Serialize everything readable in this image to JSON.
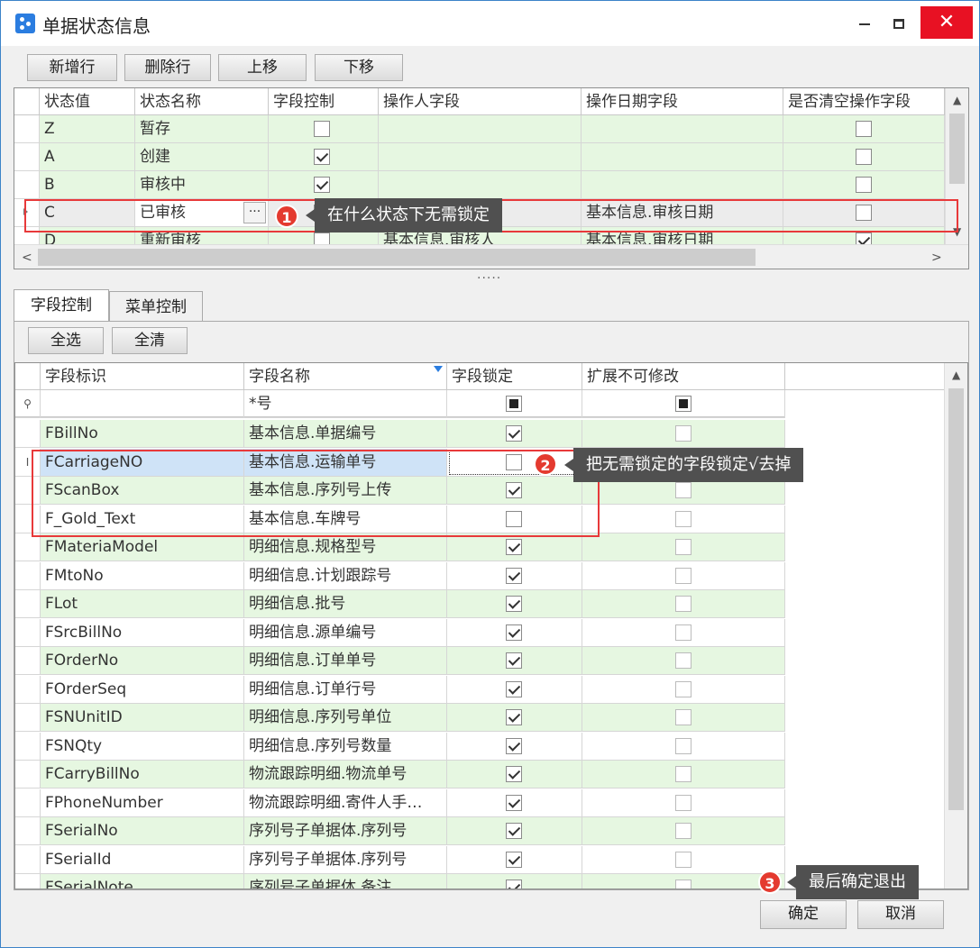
{
  "window": {
    "title": "单据状态信息",
    "close_glyph": "✕"
  },
  "toolbar": {
    "add": "新增行",
    "delete": "删除行",
    "up": "上移",
    "down": "下移"
  },
  "status_grid": {
    "columns": [
      "状态值",
      "状态名称",
      "字段控制",
      "操作人字段",
      "操作日期字段",
      "是否清空操作字段"
    ],
    "rows": [
      {
        "value": "Z",
        "name": "暂存",
        "field_control": false,
        "operator": "",
        "date": "",
        "clear": false
      },
      {
        "value": "A",
        "name": "创建",
        "field_control": true,
        "operator": "",
        "date": "",
        "clear": false
      },
      {
        "value": "B",
        "name": "审核中",
        "field_control": true,
        "operator": "",
        "date": "",
        "clear": false
      },
      {
        "value": "C",
        "name": "已审核",
        "field_control": false,
        "operator": "",
        "date": "基本信息.审核日期",
        "clear": false
      },
      {
        "value": "D",
        "name": "重新审核",
        "field_control": false,
        "operator": "基本信息.审核人",
        "date": "基本信息.审核日期",
        "clear": true
      }
    ],
    "ellipsis": "···"
  },
  "splitter": "·····",
  "tabs": [
    "字段控制",
    "菜单控制"
  ],
  "field_toolbar": {
    "select_all": "全选",
    "clear_all": "全清"
  },
  "field_grid": {
    "columns": [
      "字段标识",
      "字段名称",
      "字段锁定",
      "扩展不可修改"
    ],
    "filter": {
      "name": "*号"
    },
    "rows": [
      {
        "id": "FBillNo",
        "name": "基本信息.单据编号",
        "lock": true,
        "ext": false
      },
      {
        "id": "FCarriageNO",
        "name": "基本信息.运输单号",
        "lock": false,
        "ext": false
      },
      {
        "id": "FScanBox",
        "name": "基本信息.序列号上传",
        "lock": true,
        "ext": false
      },
      {
        "id": "F_Gold_Text",
        "name": "基本信息.车牌号",
        "lock": false,
        "ext": false
      },
      {
        "id": "FMateriaModel",
        "name": "明细信息.规格型号",
        "lock": true,
        "ext": false
      },
      {
        "id": "FMtoNo",
        "name": "明细信息.计划跟踪号",
        "lock": true,
        "ext": false
      },
      {
        "id": "FLot",
        "name": "明细信息.批号",
        "lock": true,
        "ext": false
      },
      {
        "id": "FSrcBillNo",
        "name": "明细信息.源单编号",
        "lock": true,
        "ext": false
      },
      {
        "id": "FOrderNo",
        "name": "明细信息.订单单号",
        "lock": true,
        "ext": false
      },
      {
        "id": "FOrderSeq",
        "name": "明细信息.订单行号",
        "lock": true,
        "ext": false
      },
      {
        "id": "FSNUnitID",
        "name": "明细信息.序列号单位",
        "lock": true,
        "ext": false
      },
      {
        "id": "FSNQty",
        "name": "明细信息.序列号数量",
        "lock": true,
        "ext": false
      },
      {
        "id": "FCarryBillNo",
        "name": "物流跟踪明细.物流单号",
        "lock": true,
        "ext": false
      },
      {
        "id": "FPhoneNumber",
        "name": "物流跟踪明细.寄件人手…",
        "lock": true,
        "ext": false
      },
      {
        "id": "FSerialNo",
        "name": "序列号子单据体.序列号",
        "lock": true,
        "ext": false
      },
      {
        "id": "FSerialId",
        "name": "序列号子单据体.序列号",
        "lock": true,
        "ext": false
      },
      {
        "id": "FSerialNote",
        "name": "序列号子单据体.备注",
        "lock": true,
        "ext": false
      }
    ]
  },
  "annotations": [
    {
      "num": "1",
      "text": "在什么状态下无需锁定"
    },
    {
      "num": "2",
      "text": "把无需锁定的字段锁定√去掉"
    },
    {
      "num": "3",
      "text": "最后确定退出"
    }
  ],
  "footer": {
    "ok": "确定",
    "cancel": "取消"
  },
  "colors": {
    "row_green": "#e6f7e1",
    "callout": "#505050",
    "badge": "#e43a2f",
    "highlight": "#e8393a"
  }
}
